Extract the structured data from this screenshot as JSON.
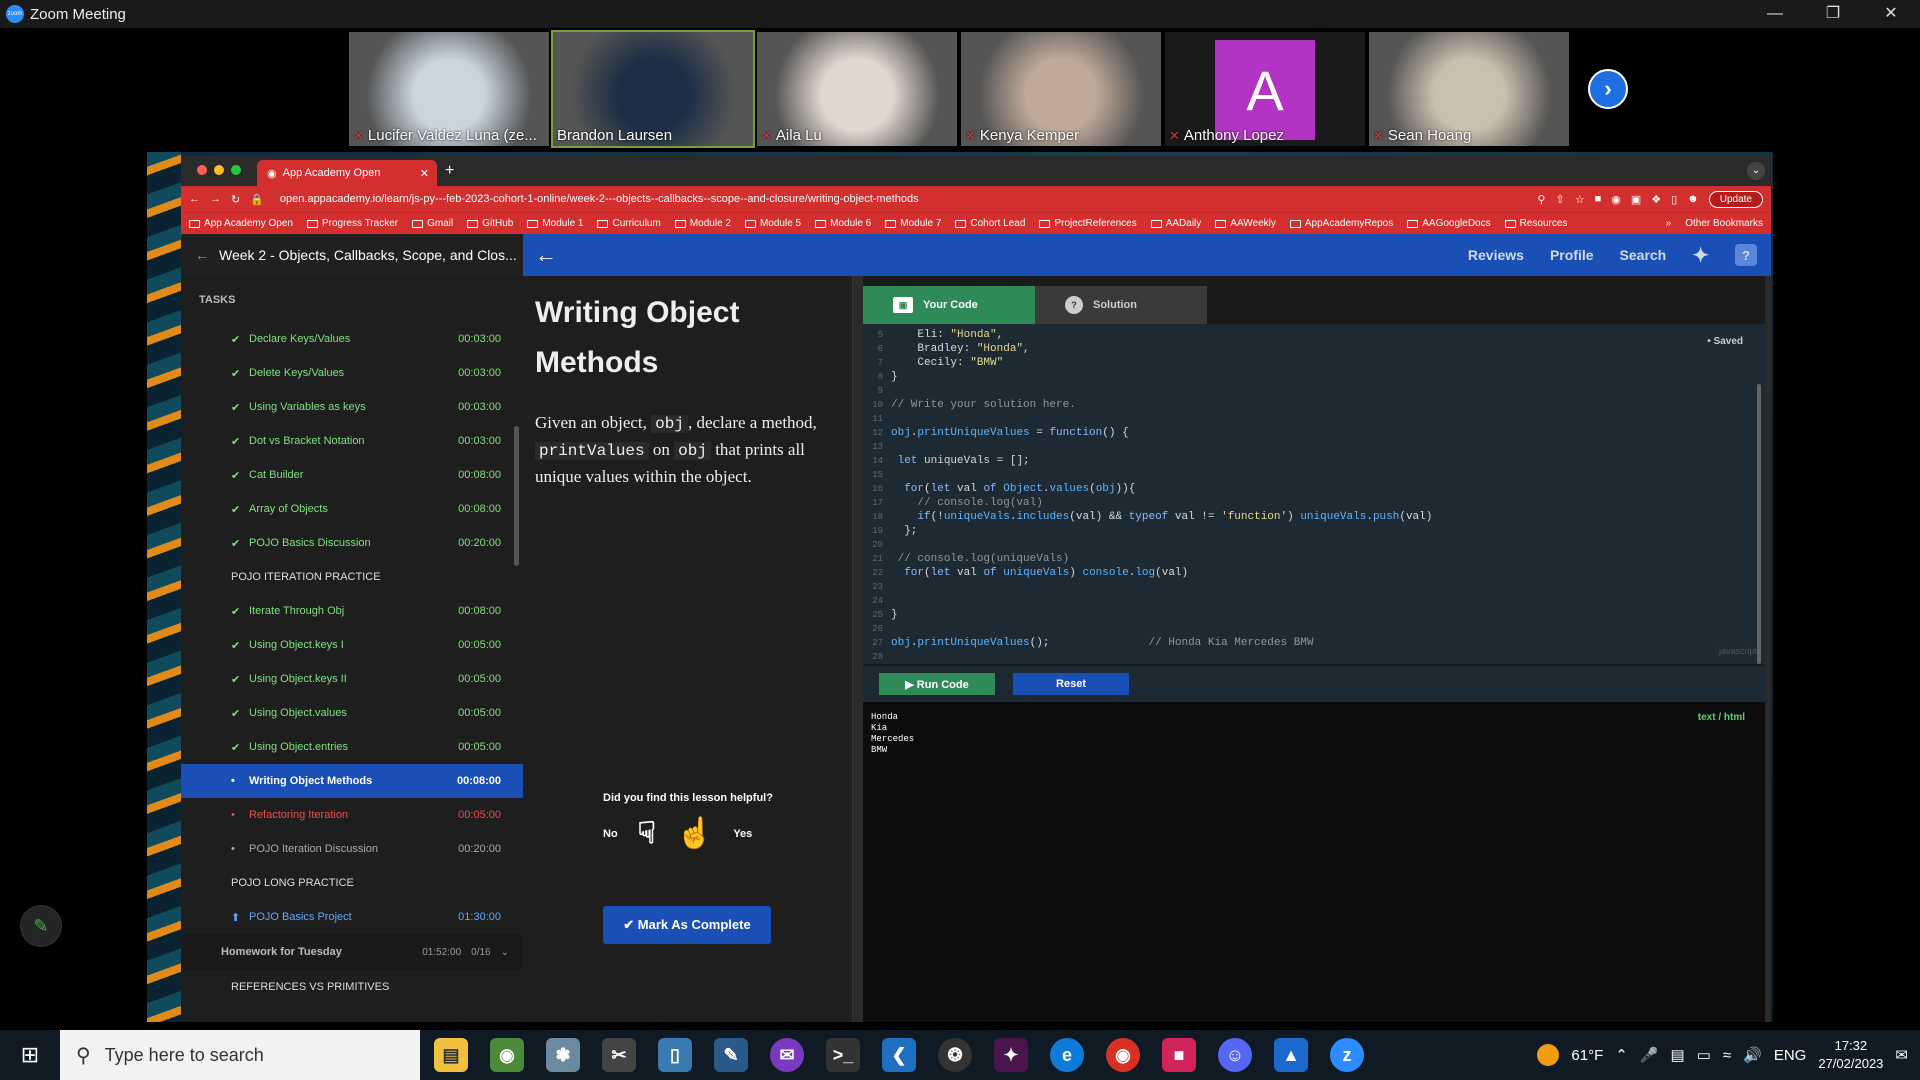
{
  "zoom": {
    "title": "Zoom Meeting",
    "participants": [
      {
        "name": "Lucifer Valdez Luna (ze...",
        "muted": true,
        "color": "#c9d6df"
      },
      {
        "name": "Brandon Laursen",
        "muted": false,
        "color": "#1b2e44"
      },
      {
        "name": "Aila Lu",
        "muted": true,
        "color": "#e2d8cf"
      },
      {
        "name": "Kenya Kemper",
        "muted": true,
        "color": "#bfa999"
      },
      {
        "name": "Anthony Lopez",
        "muted": true,
        "avatar_letter": "A",
        "color": "#b233c4"
      },
      {
        "name": "Sean Hoang",
        "muted": true,
        "color": "#cbbfae"
      }
    ]
  },
  "browser": {
    "tab_title": "App Academy Open",
    "url": "open.appacademy.io/learn/js-py---feb-2023-cohort-1-online/week-2---objects--callbacks--scope--and-closure/writing-object-methods",
    "update_label": "Update",
    "bookmarks": [
      "App Academy Open",
      "Progress Tracker",
      "Gmail",
      "GitHub",
      "Module 1",
      "Curriculum",
      "Module 2",
      "Module 5",
      "Module 6",
      "Module 7",
      "Cohort Lead",
      "ProjectReferences",
      "AADaily",
      "AAWeekly",
      "AppAcademyRepos",
      "AAGoogleDocs",
      "Resources"
    ],
    "other_bookmarks": "Other Bookmarks"
  },
  "header": {
    "week_title": "Week 2 - Objects, Callbacks, Scope, and Clos...",
    "nav": [
      "Reviews",
      "Profile",
      "Search"
    ]
  },
  "sidebar": {
    "tasks_label": "TASKS",
    "items_a": [
      {
        "label": "Declare Keys/Values",
        "time": "00:03:00"
      },
      {
        "label": "Delete Keys/Values",
        "time": "00:03:00"
      },
      {
        "label": "Using Variables as keys",
        "time": "00:03:00"
      },
      {
        "label": "Dot vs Bracket Notation",
        "time": "00:03:00"
      },
      {
        "label": "Cat Builder",
        "time": "00:08:00"
      },
      {
        "label": "Array of Objects",
        "time": "00:08:00"
      },
      {
        "label": "POJO Basics Discussion",
        "time": "00:20:00"
      }
    ],
    "section_iter": "POJO ITERATION PRACTICE",
    "items_b": [
      {
        "label": "Iterate Through Obj",
        "time": "00:08:00"
      },
      {
        "label": "Using Object.keys I",
        "time": "00:05:00"
      },
      {
        "label": "Using Object.keys II",
        "time": "00:05:00"
      },
      {
        "label": "Using Object.values",
        "time": "00:05:00"
      },
      {
        "label": "Using Object.entries",
        "time": "00:05:00"
      }
    ],
    "active": {
      "label": "Writing Object Methods",
      "time": "00:08:00"
    },
    "refactor": {
      "label": "Refactoring Iteration",
      "time": "00:05:00"
    },
    "discussion": {
      "label": "POJO Iteration Discussion",
      "time": "00:20:00"
    },
    "section_long": "POJO LONG PRACTICE",
    "project": {
      "label": "POJO Basics Project",
      "time": "01:30:00"
    },
    "homework": {
      "label": "Homework for Tuesday",
      "time": "01:52:00",
      "count": "0/16"
    },
    "section_refs": "REFERENCES VS PRIMITIVES"
  },
  "lesson": {
    "title": "Writing Object Methods",
    "p1": "Given an object,",
    "c1": "obj",
    "p2": ", declare a method,",
    "c2": "printValues",
    "p3": "on",
    "c3": "obj",
    "p4": "that prints all unique values within the object.",
    "feedback_q": "Did you find this lesson helpful?",
    "no": "No",
    "yes": "Yes",
    "mark_complete": "✔ Mark As Complete"
  },
  "editor": {
    "tab_your_code": "Your Code",
    "tab_solution": "Solution",
    "saved": "• Saved",
    "language": "javascript",
    "run": "▶ Run Code",
    "reset": "Reset",
    "output_mode": "text / html",
    "output_lines": [
      "Honda",
      "Kia",
      "Mercedes",
      "BMW"
    ]
  },
  "taskbar": {
    "search_placeholder": "Type here to search",
    "temperature": "61°F",
    "lang": "ENG",
    "time": "17:32",
    "date": "27/02/2023"
  }
}
